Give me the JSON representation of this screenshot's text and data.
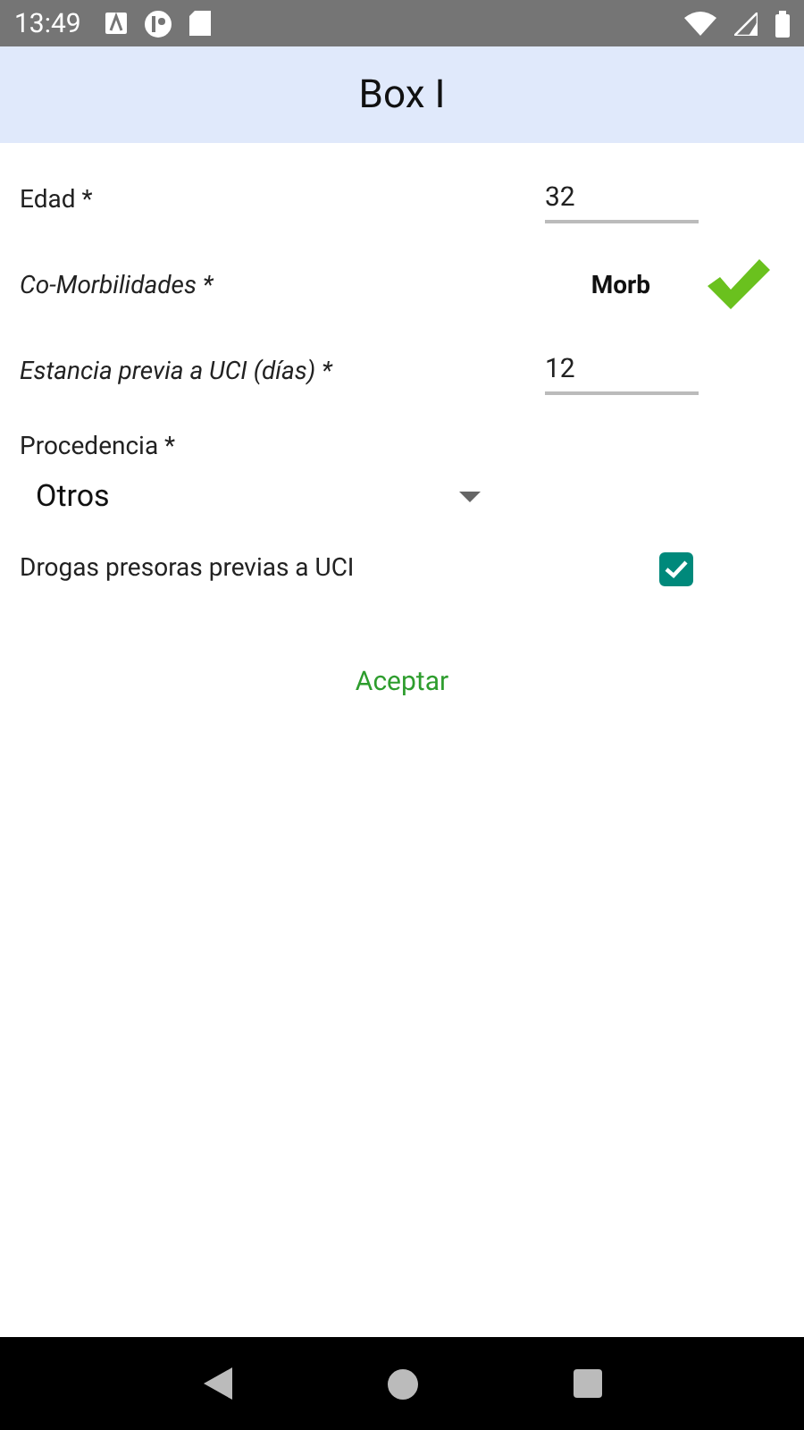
{
  "status_bar": {
    "time": "13:49"
  },
  "title": "Box I",
  "fields": [
    {
      "kind": "number",
      "label": "Edad *",
      "italic": false,
      "value": "32"
    },
    {
      "kind": "picker",
      "label": "Co-Morbilidades *",
      "italic": true,
      "button": "Morb",
      "checked": true
    },
    {
      "kind": "number",
      "label": "Estancia previa a UCI (días) *",
      "italic": true,
      "value": "12"
    },
    {
      "kind": "select",
      "label": "Procedencia *",
      "italic": false,
      "value": "Otros"
    },
    {
      "kind": "checkbox",
      "label": "Drogas presoras previas a UCI",
      "italic": false,
      "checked": true
    }
  ],
  "submit": "Aceptar"
}
